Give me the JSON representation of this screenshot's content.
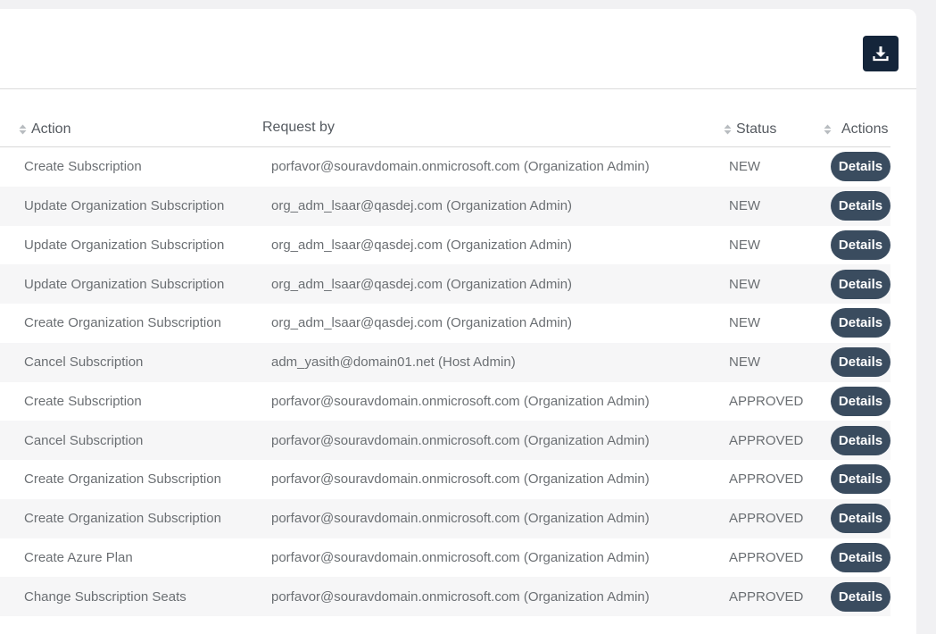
{
  "toolbar": {
    "download_icon": "download-icon"
  },
  "table": {
    "headers": {
      "action": "Action",
      "request_by": "Request by",
      "status": "Status",
      "actions": "Actions"
    },
    "rows": [
      {
        "action": "Create Subscription",
        "request_by": "porfavor@souravdomain.onmicrosoft.com (Organization Admin)",
        "status": "NEW",
        "button": "Details"
      },
      {
        "action": "Update Organization Subscription",
        "request_by": "org_adm_lsaar@qasdej.com (Organization Admin)",
        "status": "NEW",
        "button": "Details"
      },
      {
        "action": "Update Organization Subscription",
        "request_by": "org_adm_lsaar@qasdej.com (Organization Admin)",
        "status": "NEW",
        "button": "Details"
      },
      {
        "action": "Update Organization Subscription",
        "request_by": "org_adm_lsaar@qasdej.com (Organization Admin)",
        "status": "NEW",
        "button": "Details"
      },
      {
        "action": "Create Organization Subscription",
        "request_by": "org_adm_lsaar@qasdej.com (Organization Admin)",
        "status": "NEW",
        "button": "Details"
      },
      {
        "action": "Cancel Subscription",
        "request_by": "adm_yasith@domain01.net (Host Admin)",
        "status": "NEW",
        "button": "Details"
      },
      {
        "action": "Create Subscription",
        "request_by": "porfavor@souravdomain.onmicrosoft.com (Organization Admin)",
        "status": "APPROVED",
        "button": "Details"
      },
      {
        "action": "Cancel Subscription",
        "request_by": "porfavor@souravdomain.onmicrosoft.com (Organization Admin)",
        "status": "APPROVED",
        "button": "Details"
      },
      {
        "action": "Create Organization Subscription",
        "request_by": "porfavor@souravdomain.onmicrosoft.com (Organization Admin)",
        "status": "APPROVED",
        "button": "Details"
      },
      {
        "action": "Create Organization Subscription",
        "request_by": "porfavor@souravdomain.onmicrosoft.com (Organization Admin)",
        "status": "APPROVED",
        "button": "Details"
      },
      {
        "action": "Create Azure Plan",
        "request_by": "porfavor@souravdomain.onmicrosoft.com (Organization Admin)",
        "status": "APPROVED",
        "button": "Details"
      },
      {
        "action": "Change Subscription Seats",
        "request_by": "porfavor@souravdomain.onmicrosoft.com (Organization Admin)",
        "status": "APPROVED",
        "button": "Details"
      }
    ]
  },
  "colors": {
    "download_bg": "#14253a",
    "details_bg": "#3a4c5f",
    "alt_row_bg": "#f6f6f7"
  }
}
